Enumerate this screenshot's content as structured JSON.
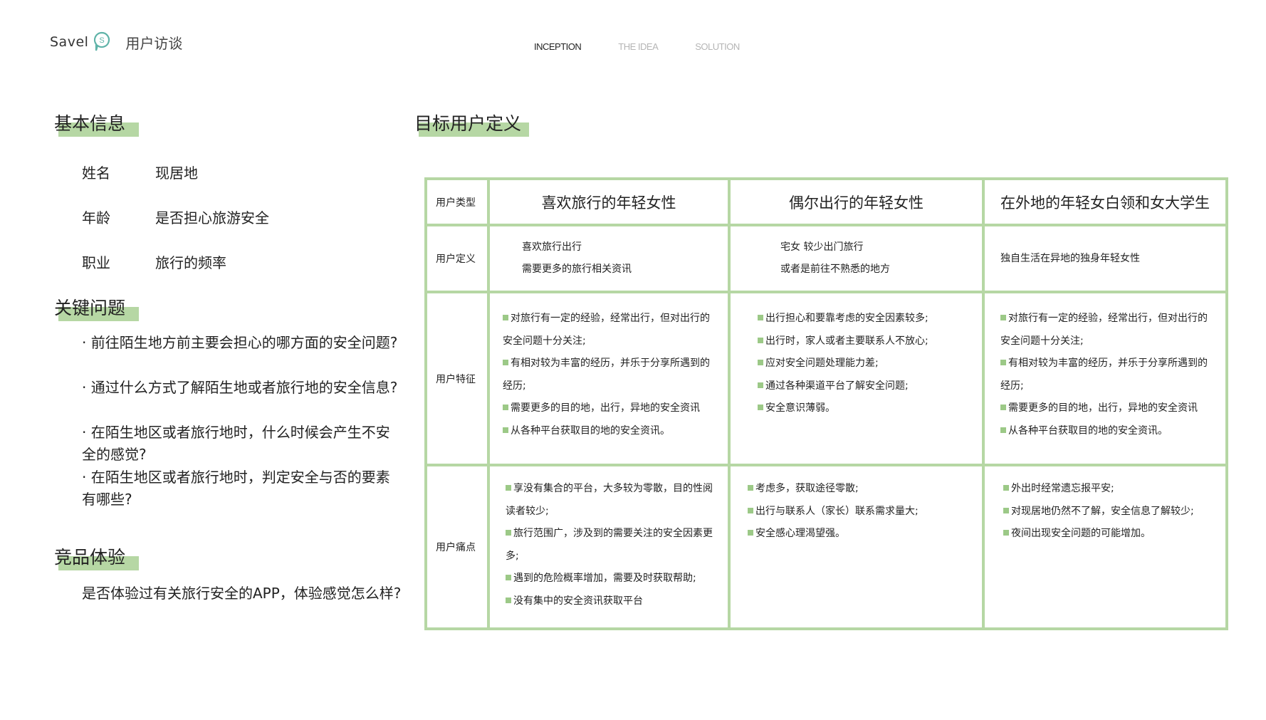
{
  "header": {
    "brand": "Savel",
    "section": "用户访谈",
    "nav": [
      "INCEPTION",
      "THE IDEA",
      "SOLUTION"
    ],
    "accent_color": "#b6d7a4",
    "logo_color": "#5fb3a8"
  },
  "basic_info": {
    "title": "基本信息",
    "rows": [
      {
        "left": "姓名",
        "right": "现居地"
      },
      {
        "left": "年龄",
        "right": "是否担心旅游安全"
      },
      {
        "left": "职业",
        "right": "旅行的频率"
      }
    ]
  },
  "key_questions": {
    "title": "关键问题",
    "items": [
      "· 前往陌生地方前主要会担心的哪方面的安全问题?",
      "· 通过什么方式了解陌生地或者旅行地的安全信息?",
      "· 在陌生地区或者旅行地时，什么时候会产生不安全的感觉?",
      "· 在陌生地区或者旅行地时，判定安全与否的要素有哪些?"
    ]
  },
  "competitor": {
    "title": "竞品体验",
    "text": "是否体验过有关旅行安全的APP，体验感觉怎么样?"
  },
  "target_users": {
    "title": "目标用户定义",
    "row_labels": [
      "用户类型",
      "用户定义",
      "用户特征",
      "用户痛点"
    ],
    "columns": [
      {
        "type": "喜欢旅行的年轻女性",
        "definition": [
          "喜欢旅行出行",
          "需要更多的旅行相关资讯"
        ],
        "traits": [
          "对旅行有一定的经验，经常出行，但对出行的安全问题十分关注;",
          "有相对较为丰富的经历，并乐于分享所遇到的经历;",
          "需要更多的目的地，出行，异地的安全资讯",
          "从各种平台获取目的地的安全资讯。"
        ],
        "pains": [
          "享没有集合的平台，大多较为零散，目的性阅读者较少;",
          "旅行范围广，涉及到的需要关注的安全因素更多;",
          "遇到的危险概率增加，需要及时获取帮助;",
          "没有集中的安全资讯获取平台"
        ]
      },
      {
        "type": "偶尔出行的年轻女性",
        "definition": [
          "宅女 较少出门旅行",
          "或者是前往不熟悉的地方"
        ],
        "traits": [
          "出行担心和要靠考虑的安全因素较多;",
          "出行时，家人或者主要联系人不放心;",
          "应对安全问题处理能力差;",
          "通过各种渠道平台了解安全问题;",
          "安全意识薄弱。"
        ],
        "pains": [
          "考虑多，获取途径零散;",
          "出行与联系人（家长）联系需求量大;",
          "安全感心理渴望强。"
        ]
      },
      {
        "type": "在外地的年轻女白领和女大学生",
        "definition": [
          "独自生活在异地的独身年轻女性"
        ],
        "traits": [
          "对旅行有一定的经验，经常出行，但对出行的安全问题十分关注;",
          "有相对较为丰富的经历，并乐于分享所遇到的经历;",
          "需要更多的目的地，出行，异地的安全资讯",
          "从各种平台获取目的地的安全资讯。"
        ],
        "pains": [
          "外出时经常遗忘报平安;",
          "对现居地仍然不了解，安全信息了解较少;",
          "夜间出现安全问题的可能增加。"
        ]
      }
    ]
  }
}
